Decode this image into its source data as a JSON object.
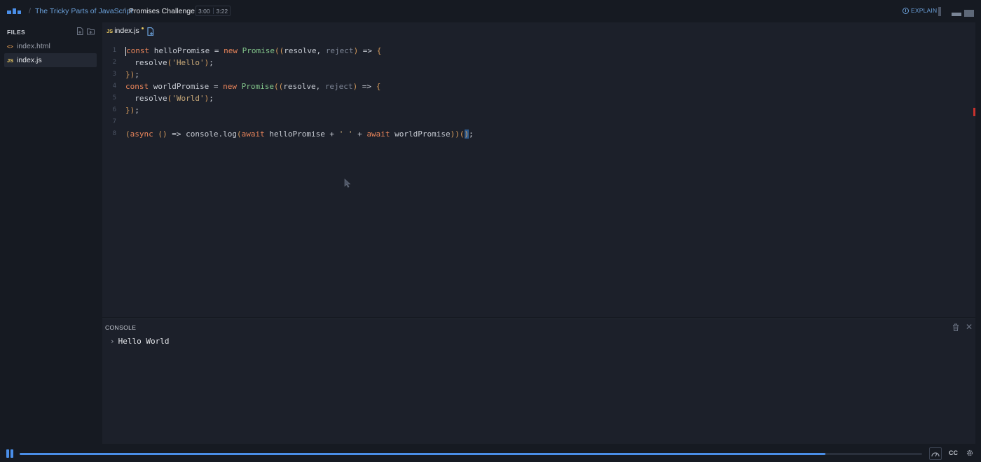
{
  "header": {
    "course_title": "The Tricky Parts of JavaScript",
    "separator": "/",
    "lesson_title": "Promises Challenge",
    "time_current": "3:00",
    "time_total": "3:22",
    "explain_label": "EXPLAIN"
  },
  "sidebar": {
    "title": "FILES",
    "files": [
      {
        "icon": "<>",
        "name": "index.html",
        "active": false
      },
      {
        "icon": "JS",
        "name": "index.js",
        "active": true
      }
    ]
  },
  "editor": {
    "tab_icon": "JS",
    "tab_name": "index.js",
    "line_numbers": [
      "1",
      "2",
      "3",
      "4",
      "5",
      "6",
      "7",
      "8"
    ],
    "code_lines": [
      "const helloPromise = new Promise((resolve, reject) => {",
      "  resolve('Hello');",
      "});",
      "const worldPromise = new Promise((resolve, reject) => {",
      "  resolve('World');",
      "});",
      "",
      "(async () => console.log(await helloPromise + ' ' + await worldPromise))();"
    ]
  },
  "console": {
    "title": "CONSOLE",
    "prompt": "›",
    "output": "Hello World"
  },
  "player": {
    "progress": 0.893,
    "cc_label": "CC"
  },
  "colors": {
    "accent": "#4a8ee8",
    "link": "#6a9fd8",
    "keyword": "#e8845a",
    "class": "#82c48a",
    "string": "#c8a878"
  }
}
